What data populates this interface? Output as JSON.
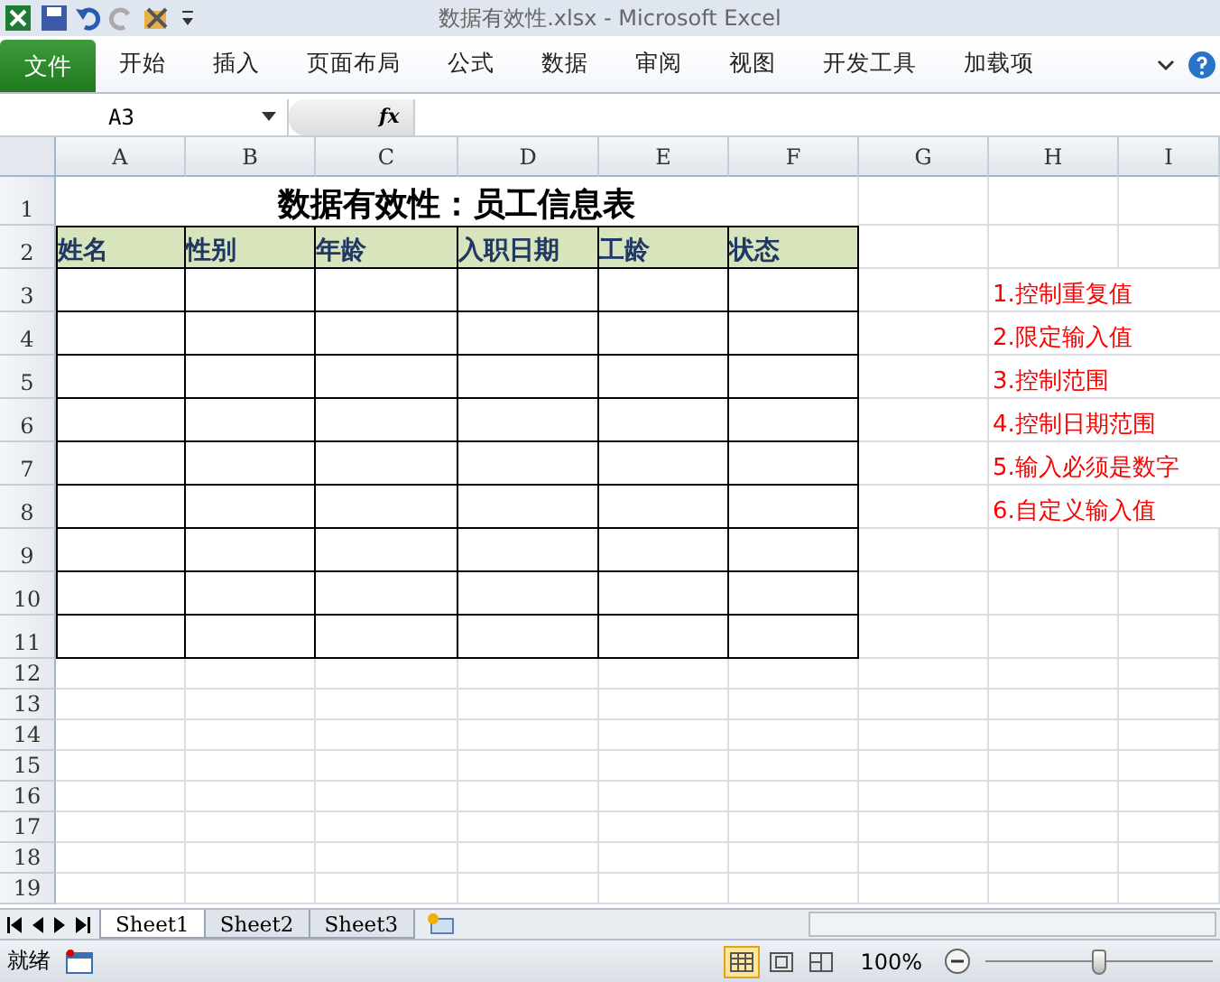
{
  "window": {
    "title": "数据有效性.xlsx  -  Microsoft Excel"
  },
  "ribbon": {
    "file_tab": "文件",
    "tabs": [
      {
        "label": "开始",
        "selected": false
      },
      {
        "label": "插入",
        "selected": false
      },
      {
        "label": "页面布局",
        "selected": false
      },
      {
        "label": "公式",
        "selected": false
      },
      {
        "label": "数据",
        "selected": false
      },
      {
        "label": "审阅",
        "selected": false
      },
      {
        "label": "视图",
        "selected": false
      },
      {
        "label": "开发工具",
        "selected": false
      },
      {
        "label": "加载项",
        "selected": false
      }
    ]
  },
  "formula_bar": {
    "name_box": "A3",
    "fx": "fx"
  },
  "sheet": {
    "columns": [
      "A",
      "B",
      "C",
      "D",
      "E",
      "F",
      "G",
      "H",
      "I"
    ],
    "rows": [
      "1",
      "2",
      "3",
      "4",
      "5",
      "6",
      "7",
      "8",
      "9",
      "10",
      "11",
      "12",
      "13",
      "14",
      "15",
      "16",
      "17",
      "18",
      "19"
    ],
    "title": "数据有效性：员工信息表",
    "headers": [
      "姓名",
      "性别",
      "年龄",
      "入职日期",
      "工龄",
      "状态"
    ],
    "notes": [
      "1.控制重复值",
      "2.限定输入值",
      "3.控制范围",
      "4.控制日期范围",
      "5.输入必须是数字",
      "6.自定义输入值"
    ]
  },
  "sheet_tabs": [
    {
      "label": "Sheet1",
      "selected": true
    },
    {
      "label": "Sheet2",
      "selected": false
    },
    {
      "label": "Sheet3",
      "selected": false
    }
  ],
  "status_bar": {
    "status": "就绪",
    "views": [
      {
        "kind": "normal",
        "selected": true
      },
      {
        "kind": "layout",
        "selected": false
      },
      {
        "kind": "pagebreak",
        "selected": false
      }
    ],
    "zoom": "100%",
    "zoom_slider": {
      "level": 0.5
    }
  }
}
